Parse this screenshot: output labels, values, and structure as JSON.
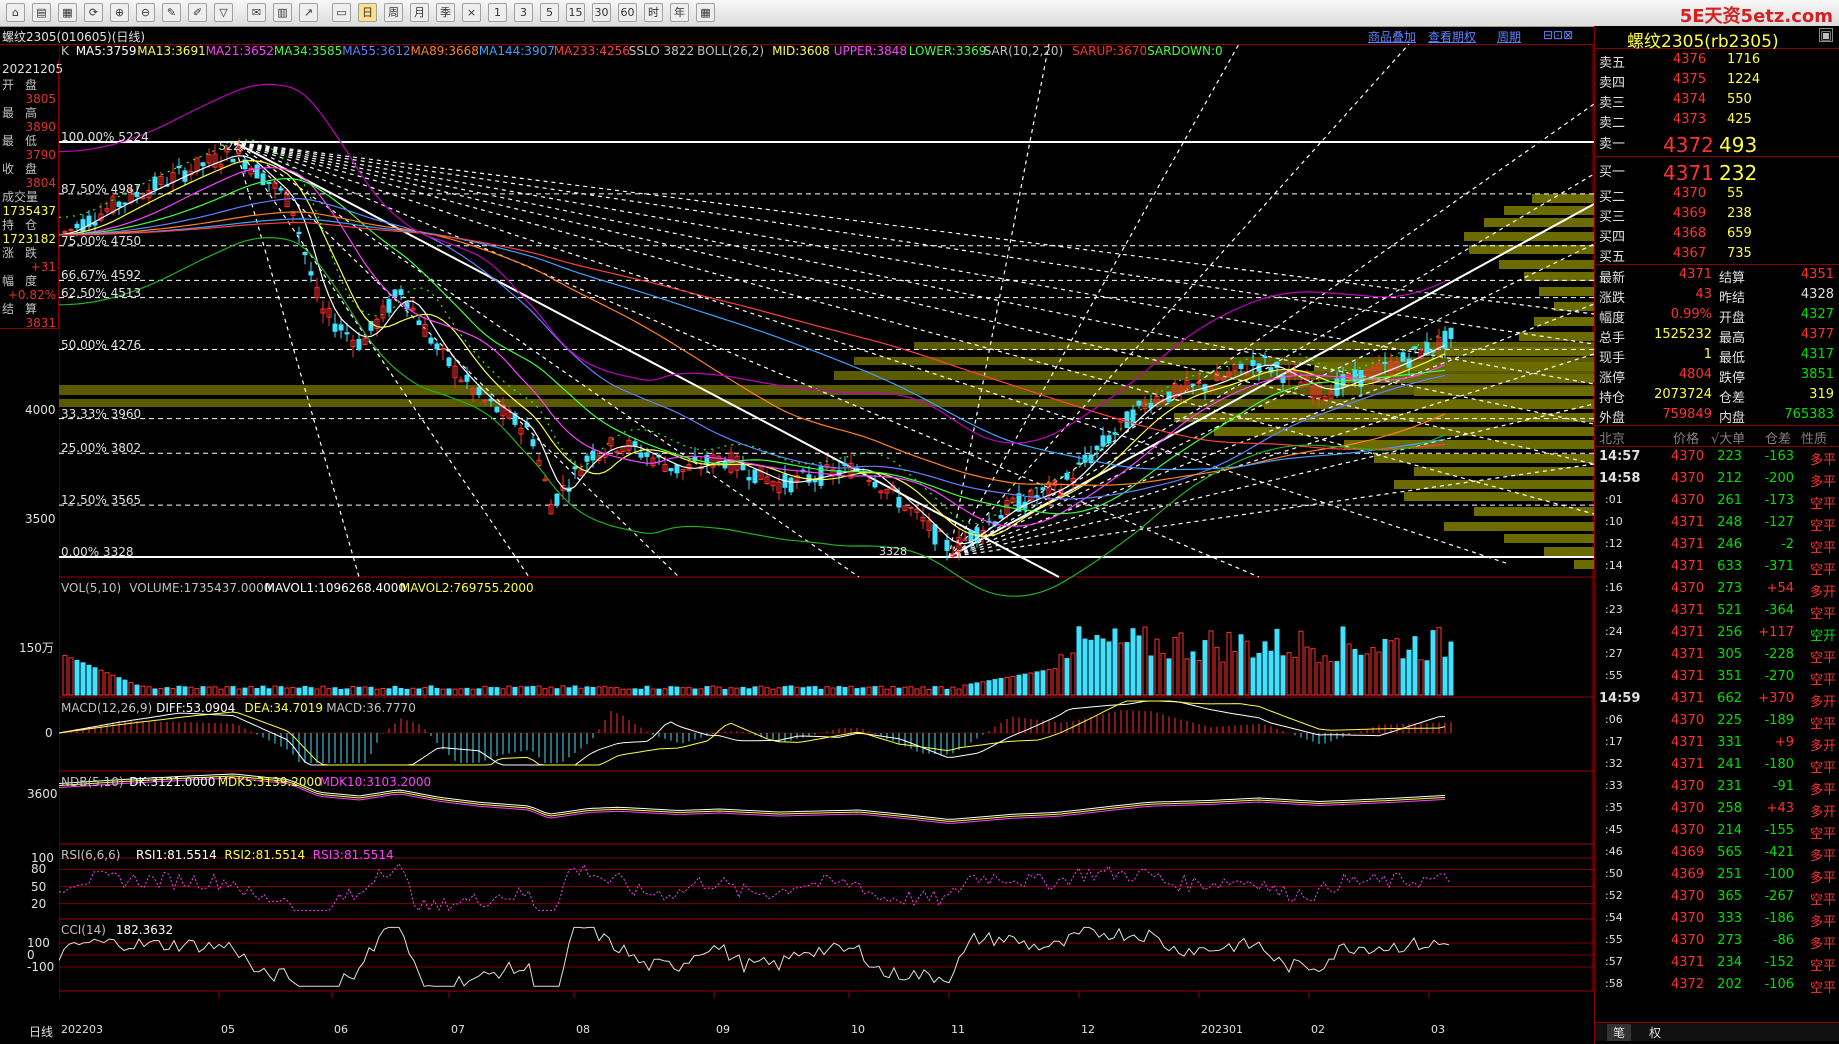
{
  "toolbar": {
    "brand": "5E天资5etz.com",
    "buttons": [
      "home",
      "folder",
      "chart",
      "refresh",
      "zoom-in",
      "zoom-out",
      "draw",
      "pen",
      "filter",
      "chat",
      "table",
      "line",
      "tag",
      "day",
      "week",
      "month",
      "quarter",
      "x",
      "1",
      "3",
      "5",
      "15",
      "30",
      "60",
      "hour",
      "year",
      "calc"
    ]
  },
  "title_bar": {
    "instrument": "螺纹2305(010605)(日线)",
    "links": [
      "商品叠加",
      "查看期权",
      "周期"
    ]
  },
  "info_panel": {
    "date": "20221205",
    "rows": [
      {
        "label": "开盘",
        "value": "3805"
      },
      {
        "label": "最高",
        "value": "3890"
      },
      {
        "label": "最低",
        "value": "3790"
      },
      {
        "label": "收盘",
        "value": "3804"
      },
      {
        "label": "成交量",
        "value": "1735437"
      },
      {
        "label": "持仓",
        "value": "1723182"
      },
      {
        "label": "涨跌",
        "value": "+31"
      },
      {
        "label": "幅度",
        "value": "+0.82%"
      },
      {
        "label": "结算",
        "value": "3831"
      }
    ]
  },
  "main_legend": [
    {
      "t": "K",
      "c": "#c0c0c0"
    },
    {
      "t": "MA5:3759",
      "c": "#ffffff"
    },
    {
      "t": "MA13:3691",
      "c": "#ffff40"
    },
    {
      "t": "MA21:3652",
      "c": "#ff40ff"
    },
    {
      "t": "MA34:3585",
      "c": "#40ff40"
    },
    {
      "t": "MA55:3612",
      "c": "#6080ff"
    },
    {
      "t": "MA89:3668",
      "c": "#ff8020"
    },
    {
      "t": "MA144:3907",
      "c": "#40a0ff"
    },
    {
      "t": "MA233:4256",
      "c": "#ff4040"
    },
    {
      "t": "SSLO 3822",
      "c": "#c0c0c0"
    },
    {
      "t": "BOLL(26,2)",
      "c": "#c0c0c0"
    },
    {
      "t": "MID:3608",
      "c": "#ffff40"
    },
    {
      "t": "UPPER:3848",
      "c": "#ff40ff"
    },
    {
      "t": "LOWER:3369",
      "c": "#40ff40"
    },
    {
      "t": "SAR(10,2,20)",
      "c": "#c0c0c0"
    },
    {
      "t": "SARUP:3670",
      "c": "#ff3030"
    },
    {
      "t": "SARDOWN:0",
      "c": "#40ff40"
    }
  ],
  "fib_levels": [
    {
      "label": "100.00% 5224",
      "price": 5224
    },
    {
      "label": "87.50% 4987",
      "price": 4987
    },
    {
      "label": "75.00% 4750",
      "price": 4750
    },
    {
      "label": "66.67% 4592",
      "price": 4592
    },
    {
      "label": "62.50% 4513",
      "price": 4513
    },
    {
      "label": "50.00% 4276",
      "price": 4276
    },
    {
      "label": "33.33% 3960",
      "price": 3960
    },
    {
      "label": "25.00% 3802",
      "price": 3802
    },
    {
      "label": "12.50% 3565",
      "price": 3565
    },
    {
      "label": "0.00% 3328",
      "price": 3328
    }
  ],
  "price_axis": [
    "4000",
    "3500"
  ],
  "low_label": "3328",
  "high_label": "5224",
  "vol_legend": [
    {
      "t": "VOL(5,10)",
      "c": "#c0c0c0"
    },
    {
      "t": "VOLUME:1735437.0000",
      "c": "#c0c0c0"
    },
    {
      "t": "MAVOL1:1096268.4000",
      "c": "#ffffff"
    },
    {
      "t": "MAVOL2:769755.2000",
      "c": "#ffff40"
    }
  ],
  "vol_axis": "150万",
  "macd_legend": [
    {
      "t": "MACD(12,26,9)",
      "c": "#c0c0c0"
    },
    {
      "t": "DIFF:53.0904",
      "c": "#ffffff"
    },
    {
      "t": "DEA:34.7019",
      "c": "#ffff40"
    },
    {
      "t": "MACD:36.7770",
      "c": "#c0c0c0"
    }
  ],
  "macd_axis": "0",
  "ndb_legend": [
    {
      "t": "NDB(5,10)",
      "c": "#c0c0c0"
    },
    {
      "t": "DK:3121.0000",
      "c": "#ffffff"
    },
    {
      "t": "MDK5:3139.2000",
      "c": "#ffff40"
    },
    {
      "t": "MDK10:3103.2000",
      "c": "#ff40ff"
    }
  ],
  "ndb_axis": "3600",
  "rsi_legend": [
    {
      "t": "RSI(6,6,6)",
      "c": "#c0c0c0"
    },
    {
      "t": "RSI1:81.5514",
      "c": "#ffffff"
    },
    {
      "t": "RSI2:81.5514",
      "c": "#ffff40"
    },
    {
      "t": "RSI3:81.5514",
      "c": "#ff40ff"
    }
  ],
  "rsi_axis": [
    "100",
    "80",
    "50",
    "20"
  ],
  "cci_legend": [
    {
      "t": "CCI(14)",
      "c": "#c0c0c0"
    },
    {
      "t": "182.3632",
      "c": "#ffffff"
    }
  ],
  "cci_axis": [
    "100",
    "0",
    "-100"
  ],
  "x_axis": {
    "period_label": "日线",
    "ticks": [
      "202203",
      "05",
      "06",
      "07",
      "08",
      "09",
      "10",
      "11",
      "12",
      "202301",
      "02",
      "03"
    ]
  },
  "quote": {
    "title": "螺纹2305(rb2305)",
    "asks": [
      {
        "label": "卖五",
        "price": "4376",
        "vol": "1716"
      },
      {
        "label": "卖四",
        "price": "4375",
        "vol": "1224"
      },
      {
        "label": "卖三",
        "price": "4374",
        "vol": "550"
      },
      {
        "label": "卖二",
        "price": "4373",
        "vol": "425"
      },
      {
        "label": "卖一",
        "price": "4372",
        "vol": "493"
      }
    ],
    "bids": [
      {
        "label": "买一",
        "price": "4371",
        "vol": "232"
      },
      {
        "label": "买二",
        "price": "4370",
        "vol": "55"
      },
      {
        "label": "买三",
        "price": "4369",
        "vol": "238"
      },
      {
        "label": "买四",
        "price": "4368",
        "vol": "659"
      },
      {
        "label": "买五",
        "price": "4367",
        "vol": "735"
      }
    ],
    "stats": [
      {
        "l1": "最新",
        "v1": "4371",
        "c1": "red",
        "l2": "结算",
        "v2": "4351",
        "c2": "red"
      },
      {
        "l1": "涨跌",
        "v1": "43",
        "c1": "red",
        "l2": "昨结",
        "v2": "4328",
        "c2": "white"
      },
      {
        "l1": "幅度",
        "v1": "0.99%",
        "c1": "red",
        "l2": "开盘",
        "v2": "4327",
        "c2": "green"
      },
      {
        "l1": "总手",
        "v1": "1525232",
        "c1": "yellow",
        "l2": "最高",
        "v2": "4377",
        "c2": "red"
      },
      {
        "l1": "现手",
        "v1": "1",
        "c1": "yellow",
        "l2": "最低",
        "v2": "4317",
        "c2": "green"
      },
      {
        "l1": "涨停",
        "v1": "4804",
        "c1": "red",
        "l2": "跌停",
        "v2": "3851",
        "c2": "green"
      },
      {
        "l1": "持仓",
        "v1": "2073724",
        "c1": "yellow",
        "l2": "仓差",
        "v2": "319",
        "c2": "yellow"
      },
      {
        "l1": "外盘",
        "v1": "759849",
        "c1": "red",
        "l2": "内盘",
        "v2": "765383",
        "c2": "green"
      }
    ],
    "tick_header": {
      "c0": "北京",
      "c1": "价格",
      "c2": "√大单",
      "c3": "仓差",
      "c4": "性质"
    }
  },
  "ticks": [
    {
      "t": "14:57",
      "p": "4370",
      "v": "223",
      "d": "-163",
      "n": "多平",
      "nc": "red"
    },
    {
      "t": "14:58",
      "p": "4370",
      "v": "212",
      "d": "-200",
      "n": "多平",
      "nc": "red"
    },
    {
      "t": ":01",
      "p": "4370",
      "v": "261",
      "d": "-173",
      "n": "空平",
      "nc": "red"
    },
    {
      "t": ":10",
      "p": "4371",
      "v": "248",
      "d": "-127",
      "n": "空平",
      "nc": "red"
    },
    {
      "t": ":12",
      "p": "4371",
      "v": "246",
      "d": "-2",
      "n": "空平",
      "nc": "red"
    },
    {
      "t": ":14",
      "p": "4371",
      "v": "633",
      "d": "-371",
      "n": "空平",
      "nc": "red"
    },
    {
      "t": ":16",
      "p": "4370",
      "v": "273",
      "d": "+54",
      "n": "多开",
      "nc": "red"
    },
    {
      "t": ":23",
      "p": "4371",
      "v": "521",
      "d": "-364",
      "n": "空平",
      "nc": "red"
    },
    {
      "t": ":24",
      "p": "4371",
      "v": "256",
      "d": "+117",
      "n": "空开",
      "nc": "green"
    },
    {
      "t": ":27",
      "p": "4371",
      "v": "305",
      "d": "-228",
      "n": "空平",
      "nc": "red"
    },
    {
      "t": ":55",
      "p": "4371",
      "v": "351",
      "d": "-270",
      "n": "空平",
      "nc": "red"
    },
    {
      "t": "14:59",
      "p": "4371",
      "v": "662",
      "d": "+370",
      "n": "多开",
      "nc": "red"
    },
    {
      "t": ":06",
      "p": "4370",
      "v": "225",
      "d": "-189",
      "n": "空平",
      "nc": "red"
    },
    {
      "t": ":17",
      "p": "4371",
      "v": "331",
      "d": "+9",
      "n": "多开",
      "nc": "red"
    },
    {
      "t": ":32",
      "p": "4371",
      "v": "241",
      "d": "-180",
      "n": "空平",
      "nc": "red"
    },
    {
      "t": ":33",
      "p": "4370",
      "v": "231",
      "d": "-91",
      "n": "多平",
      "nc": "red"
    },
    {
      "t": ":35",
      "p": "4370",
      "v": "258",
      "d": "+43",
      "n": "多开",
      "nc": "red"
    },
    {
      "t": ":45",
      "p": "4370",
      "v": "214",
      "d": "-155",
      "n": "空平",
      "nc": "red"
    },
    {
      "t": ":46",
      "p": "4369",
      "v": "565",
      "d": "-421",
      "n": "多平",
      "nc": "red"
    },
    {
      "t": ":50",
      "p": "4369",
      "v": "251",
      "d": "-100",
      "n": "多平",
      "nc": "red"
    },
    {
      "t": ":52",
      "p": "4370",
      "v": "365",
      "d": "-267",
      "n": "空平",
      "nc": "red"
    },
    {
      "t": ":54",
      "p": "4370",
      "v": "333",
      "d": "-186",
      "n": "多平",
      "nc": "red"
    },
    {
      "t": ":55",
      "p": "4370",
      "v": "273",
      "d": "-86",
      "n": "多平",
      "nc": "red"
    },
    {
      "t": ":57",
      "p": "4371",
      "v": "234",
      "d": "-152",
      "n": "空平",
      "nc": "red"
    },
    {
      "t": ":58",
      "p": "4372",
      "v": "202",
      "d": "-106",
      "n": "空平",
      "nc": "red"
    }
  ],
  "bottom_tabs": [
    "笔",
    "权"
  ],
  "colors": {
    "up": "#ff3030",
    "down": "#40e0ff",
    "grid": "#800000",
    "fib": "#ffffff",
    "profile": "#6b6b00"
  }
}
